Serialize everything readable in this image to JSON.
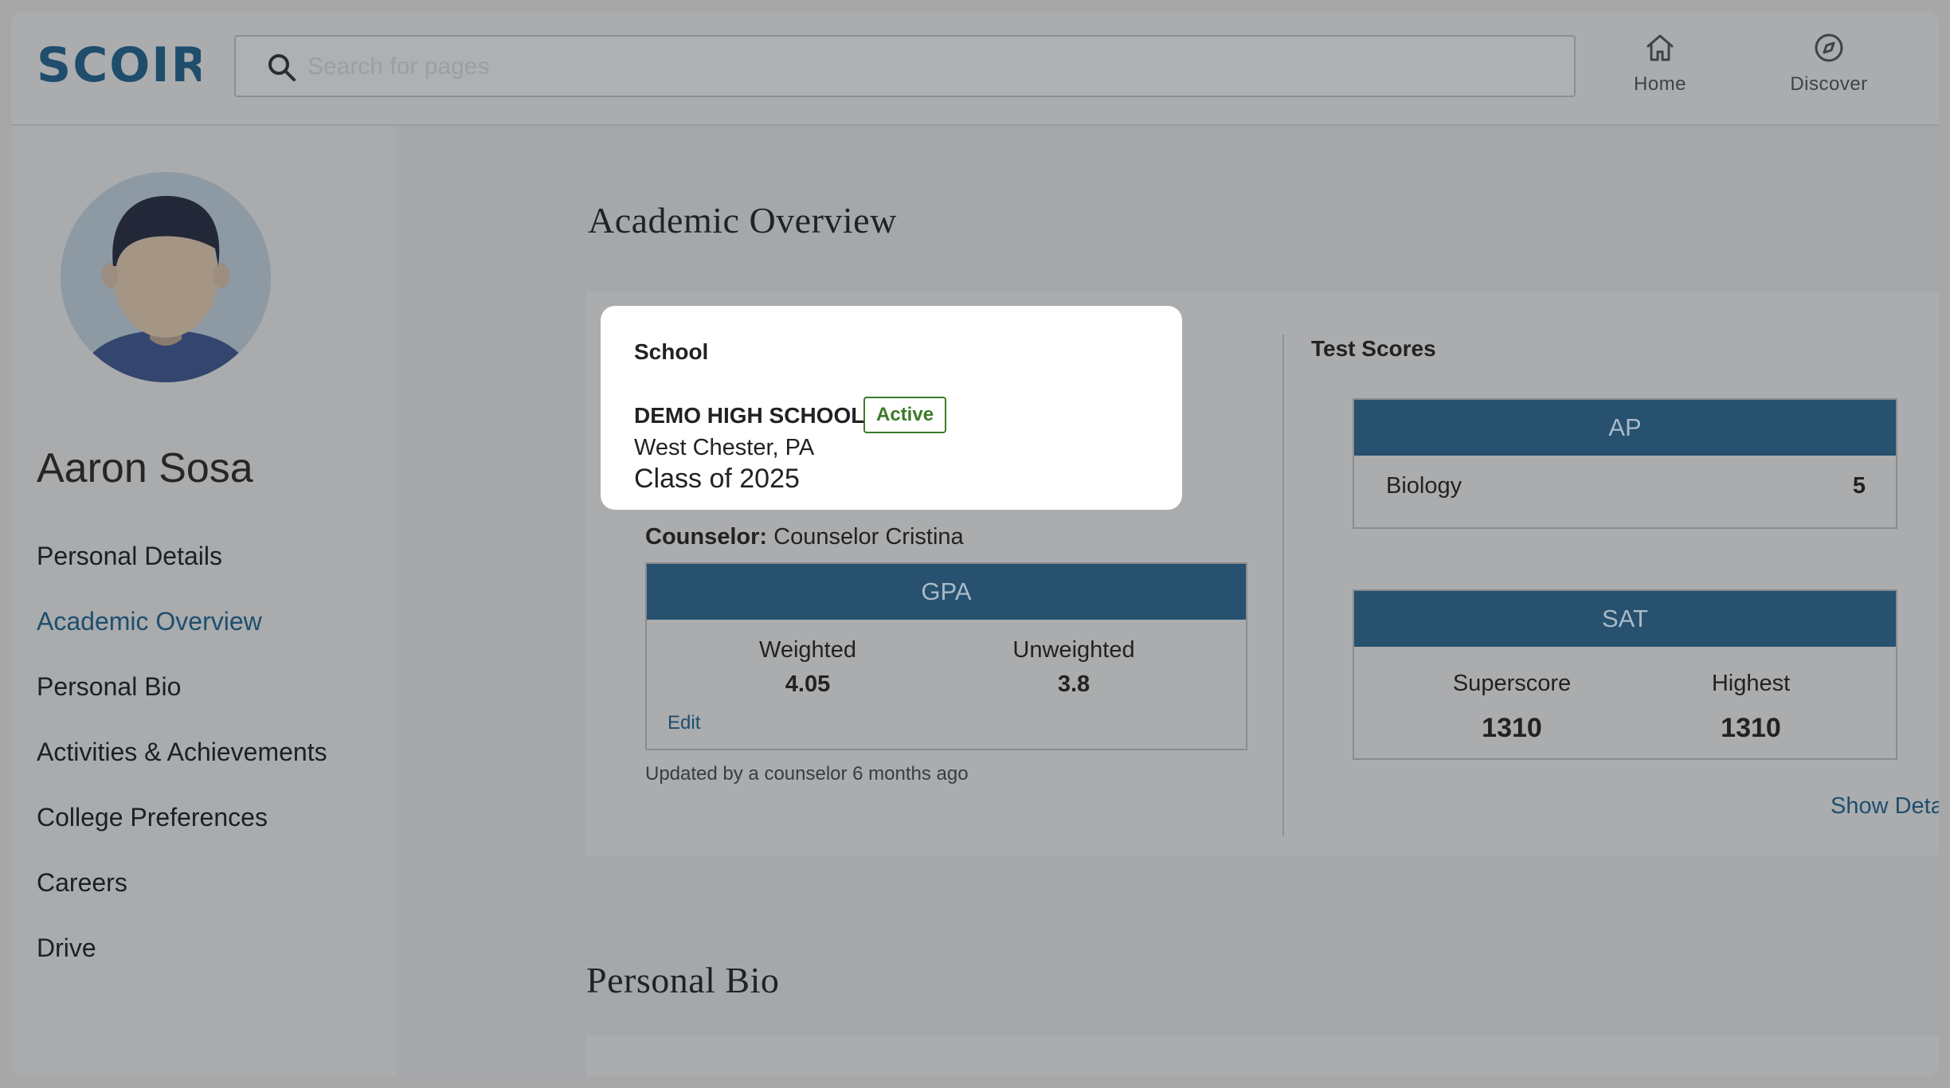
{
  "header": {
    "logo_text": "SCOIR",
    "search": {
      "placeholder": "Search for pages",
      "value": ""
    },
    "nav": [
      {
        "label": "Home",
        "icon": "home-icon"
      },
      {
        "label": "Discover",
        "icon": "compass-icon"
      }
    ]
  },
  "sidebar": {
    "user_name": "Aaron Sosa",
    "items": [
      {
        "label": "Personal Details",
        "active": false
      },
      {
        "label": "Academic Overview",
        "active": true
      },
      {
        "label": "Personal Bio",
        "active": false
      },
      {
        "label": "Activities & Achievements",
        "active": false
      },
      {
        "label": "College Preferences",
        "active": false
      },
      {
        "label": "Careers",
        "active": false
      },
      {
        "label": "Drive",
        "active": false
      }
    ]
  },
  "main": {
    "title": "Academic Overview",
    "school": {
      "label": "School",
      "name": "DEMO HIGH SCHOOL",
      "status": "Active",
      "location": "West Chester, PA",
      "class_of": "Class of 2025"
    },
    "counselor": {
      "label": "Counselor:",
      "name": "Counselor Cristina"
    },
    "gpa": {
      "title": "GPA",
      "weighted_label": "Weighted",
      "weighted": "4.05",
      "unweighted_label": "Unweighted",
      "unweighted": "3.8",
      "edit_label": "Edit",
      "updated_text": "Updated by a counselor 6 months ago"
    },
    "test_scores": {
      "label": "Test Scores",
      "ap": {
        "title": "AP",
        "subject": "Biology",
        "score": "5"
      },
      "sat": {
        "title": "SAT",
        "superscore_label": "Superscore",
        "superscore": "1310",
        "highest_label": "Highest",
        "highest": "1310"
      },
      "show_details": "Show Details"
    },
    "second_section_title": "Personal Bio"
  },
  "colors": {
    "brand": "#1f4d6b",
    "header_bar": "#27516e",
    "active_badge": "#3c7a2a",
    "link": "#1e4e6e"
  }
}
